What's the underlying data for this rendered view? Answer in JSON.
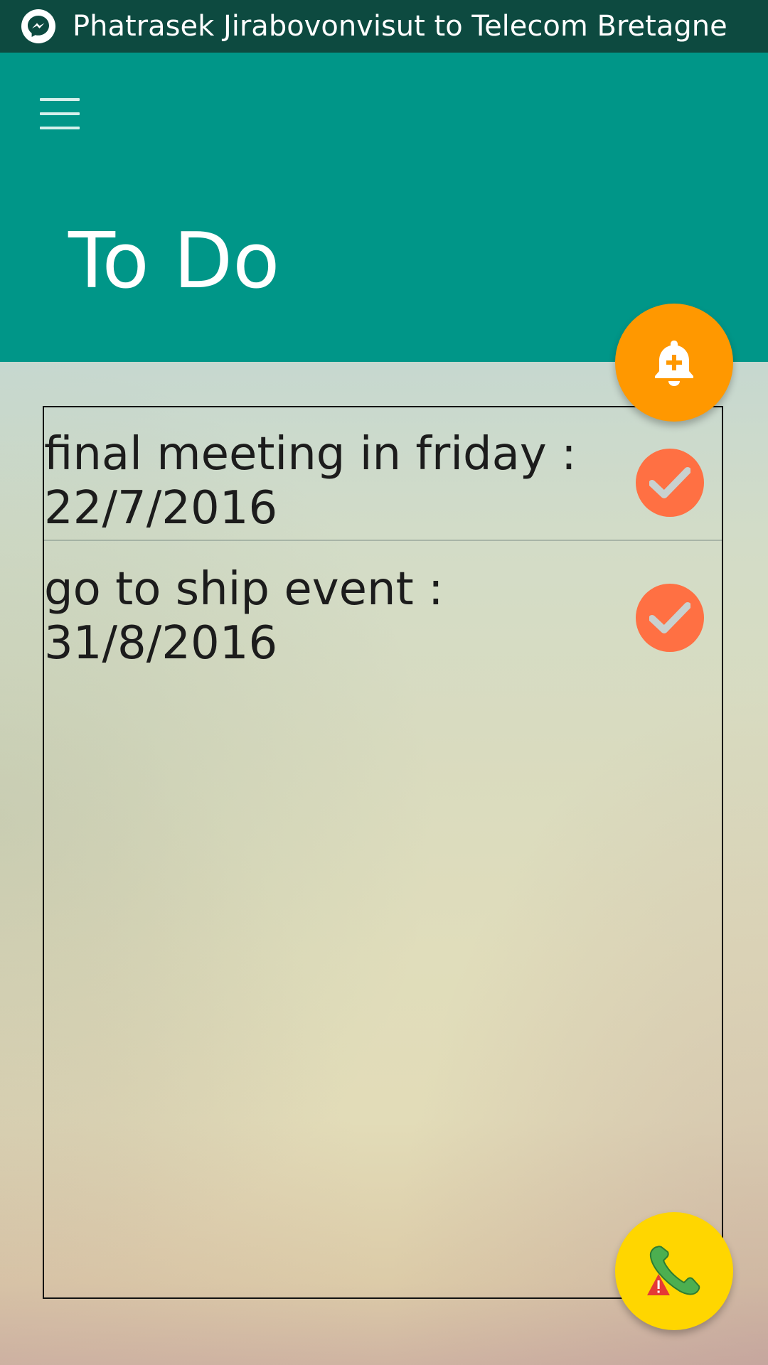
{
  "notification": {
    "icon": "messenger-icon",
    "text": "Phatrasek Jirabovonvisut to Telecom Bretagne"
  },
  "app_bar": {
    "menu_icon": "hamburger-menu-icon",
    "title": "To Do",
    "color": "#009688"
  },
  "fab_alarm": {
    "icon": "bell-plus-icon",
    "color": "#ff9800"
  },
  "todos": [
    {
      "text": "final meeting in friday : 22/7/2016",
      "icon": "check-icon"
    },
    {
      "text": "go to ship event : 31/8/2016",
      "icon": "check-icon"
    }
  ],
  "check_color": "#ff7043",
  "fab_call": {
    "icon": "phone-warning-icon",
    "color": "#ffd600"
  }
}
